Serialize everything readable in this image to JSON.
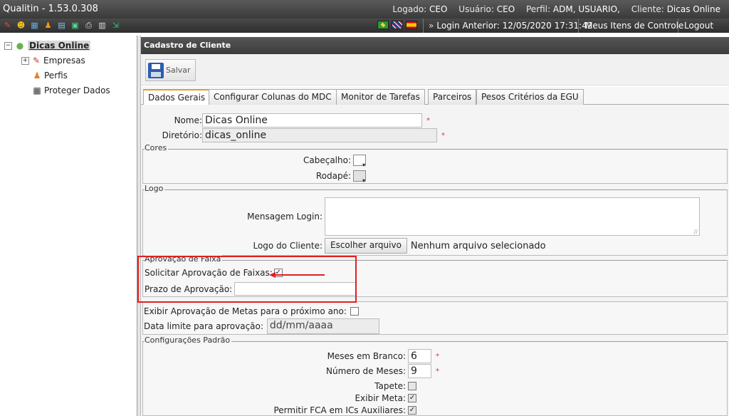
{
  "app": {
    "title": "Qualitin - 1.53.0.308",
    "logged_label": "Logado:",
    "logged_value": "CEO",
    "user_label": "Usuário:",
    "user_value": "CEO",
    "profile_label": "Perfil:",
    "profile_value": "ADM, USUARIO,",
    "client_label": "Cliente:",
    "client_value": "Dicas Online"
  },
  "secbar": {
    "last_login": "Login Anterior: 12/05/2020 17:31:42",
    "my_items": "Meus Itens de Controle",
    "logout": "Logout",
    "languages": [
      "pt-BR",
      "en-GB",
      "es-ES"
    ]
  },
  "sidebar": {
    "root": "Dicas Online",
    "items": [
      {
        "label": "Empresas",
        "icon": "company-icon"
      },
      {
        "label": "Perfis",
        "icon": "profiles-icon"
      },
      {
        "label": "Proteger Dados",
        "icon": "calendar-icon"
      }
    ]
  },
  "panel": {
    "title": "Cadastro de Cliente",
    "save": "Salvar"
  },
  "tabs": [
    "Dados Gerais",
    "Configurar Colunas do MDC",
    "Monitor de Tarefas",
    "Parceiros",
    "Pesos Critérios da EGU"
  ],
  "form": {
    "nome_label": "Nome:",
    "nome_value": "Dicas Online",
    "diretorio_label": "Diretório:",
    "diretorio_value": "dicas_online",
    "required": "*",
    "cores_legend": "Cores",
    "cabecalho_label": "Cabeçalho:",
    "rodape_label": "Rodapé:",
    "logo_legend": "Logo",
    "msg_login_label": "Mensagem Login:",
    "logo_cliente_label": "Logo do Cliente:",
    "file_button": "Escolher arquivo",
    "file_none": "Nenhum arquivo selecionado",
    "aprov_legend": "Aprovação de Faixa",
    "solicitar_label": "Solicitar Aprovação de Faixas:",
    "solicitar_checked": true,
    "prazo_label": "Prazo de Aprovação:",
    "prazo_value": "",
    "exibir_metas_label": "Exibir Aprovação de Metas para o próximo ano:",
    "data_limite_label": "Data limite para aprovação:",
    "data_limite_placeholder": "dd/mm/aaaa",
    "config_legend": "Configurações Padrão",
    "meses_branco_label": "Meses em Branco:",
    "meses_branco_value": "6",
    "numero_meses_label": "Número de Meses:",
    "numero_meses_value": "9",
    "tapete_label": "Tapete:",
    "exibir_meta_label": "Exibir Meta:",
    "permitir_fca_label": "Permitir FCA em ICs Auxiliares:"
  },
  "colors": {
    "highlight": "#e02020",
    "active_tab": "#e59a2c"
  }
}
